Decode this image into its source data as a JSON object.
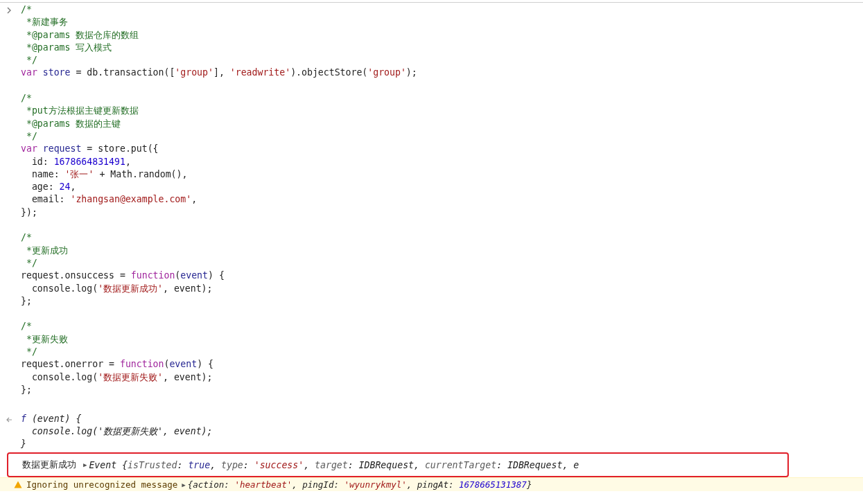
{
  "input": {
    "blocks": [
      [
        [
          {
            "text": "/*",
            "kind": "comment"
          }
        ],
        [
          {
            "text": " *新建事务",
            "kind": "comment"
          }
        ],
        [
          {
            "text": " *@params 数据仓库的数组",
            "kind": "comment"
          }
        ],
        [
          {
            "text": " *@params 写入模式",
            "kind": "comment"
          }
        ],
        [
          {
            "text": " */",
            "kind": "comment"
          }
        ],
        [
          {
            "text": "var",
            "kind": "kw"
          },
          {
            "text": "store",
            "kind": "ident"
          },
          {
            "text": "= db.transaction([",
            "kind": "plain"
          },
          {
            "text": "'group'",
            "kind": "str"
          },
          {
            "text": "],",
            "kind": "plain"
          },
          {
            "text": "'readwrite'",
            "kind": "str"
          },
          {
            "text": ").objectStore(",
            "kind": "plain"
          },
          {
            "text": "'group'",
            "kind": "str"
          },
          {
            "text": ");",
            "kind": "plain"
          }
        ]
      ],
      [
        [
          {
            "text": "/*",
            "kind": "comment"
          }
        ],
        [
          {
            "text": " *put方法根据主键更新数据",
            "kind": "comment"
          }
        ],
        [
          {
            "text": " *@params 数据的主键",
            "kind": "comment"
          }
        ],
        [
          {
            "text": " */",
            "kind": "comment"
          }
        ],
        [
          {
            "text": "var",
            "kind": "kw"
          },
          {
            "text": "request",
            "kind": "ident"
          },
          {
            "text": "= store.put({",
            "kind": "plain"
          }
        ],
        [
          {
            "text": "  id:",
            "kind": "plain"
          },
          {
            "text": "1678664831491",
            "kind": "num"
          },
          {
            "text": ",",
            "kind": "plain"
          }
        ],
        [
          {
            "text": "  name:",
            "kind": "plain"
          },
          {
            "text": "'张一'",
            "kind": "str"
          },
          {
            "text": "+ Math.random(),",
            "kind": "plain"
          }
        ],
        [
          {
            "text": "  age:",
            "kind": "plain"
          },
          {
            "text": "24",
            "kind": "num"
          },
          {
            "text": ",",
            "kind": "plain"
          }
        ],
        [
          {
            "text": "  email:",
            "kind": "plain"
          },
          {
            "text": "'zhangsan@example.com'",
            "kind": "str"
          },
          {
            "text": ",",
            "kind": "plain"
          }
        ],
        [
          {
            "text": "});",
            "kind": "plain"
          }
        ]
      ],
      [
        [
          {
            "text": "/*",
            "kind": "comment"
          }
        ],
        [
          {
            "text": " *更新成功",
            "kind": "comment"
          }
        ],
        [
          {
            "text": " */",
            "kind": "comment"
          }
        ],
        [
          {
            "text": "request.onsuccess =",
            "kind": "plain"
          },
          {
            "text": "function",
            "kind": "kw"
          },
          {
            "text": "(",
            "kind": "plain"
          },
          {
            "text": "event",
            "kind": "ident"
          },
          {
            "text": ") {",
            "kind": "plain"
          }
        ],
        [
          {
            "text": "  console.log(",
            "kind": "plain"
          },
          {
            "text": "'数据更新成功'",
            "kind": "str"
          },
          {
            "text": ", event);",
            "kind": "plain"
          }
        ],
        [
          {
            "text": "};",
            "kind": "plain"
          }
        ]
      ],
      [
        [
          {
            "text": "/*",
            "kind": "comment"
          }
        ],
        [
          {
            "text": " *更新失败",
            "kind": "comment"
          }
        ],
        [
          {
            "text": " */",
            "kind": "comment"
          }
        ],
        [
          {
            "text": "request.onerror =",
            "kind": "plain"
          },
          {
            "text": "function",
            "kind": "kw"
          },
          {
            "text": "(",
            "kind": "plain"
          },
          {
            "text": "event",
            "kind": "ident"
          },
          {
            "text": ") {",
            "kind": "plain"
          }
        ],
        [
          {
            "text": "  console.log(",
            "kind": "plain"
          },
          {
            "text": "'数据更新失败'",
            "kind": "str"
          },
          {
            "text": ", event);",
            "kind": "plain"
          }
        ],
        [
          {
            "text": "};",
            "kind": "plain"
          }
        ]
      ]
    ]
  },
  "result": {
    "lines": [
      [
        {
          "text": "f",
          "kind": "ident"
        },
        {
          "text": "(event) {",
          "kind": "plain"
        }
      ],
      [
        {
          "text": "  console.log('数据更新失败', event);",
          "kind": "plain"
        }
      ],
      [
        {
          "text": "}",
          "kind": "plain"
        }
      ]
    ]
  },
  "log": {
    "highlighted": true,
    "message": "数据更新成功",
    "arrow": "▶",
    "tokens": [
      {
        "text": "Event {",
        "kind": "plain"
      },
      {
        "text": "isTrusted",
        "kind": "key"
      },
      {
        "text": ":",
        "kind": "plain"
      },
      {
        "text": "true",
        "kind": "ident"
      },
      {
        "text": ",",
        "kind": "plain"
      },
      {
        "text": "type",
        "kind": "key"
      },
      {
        "text": ":",
        "kind": "plain"
      },
      {
        "text": "'success'",
        "kind": "str"
      },
      {
        "text": ",",
        "kind": "plain"
      },
      {
        "text": "target",
        "kind": "key"
      },
      {
        "text": ": IDBRequest,",
        "kind": "plain"
      },
      {
        "text": "currentTarget",
        "kind": "key"
      },
      {
        "text": ": IDBRequest, e",
        "kind": "plain"
      }
    ]
  },
  "warning": {
    "message": "Ignoring unrecognized message",
    "arrow": "▶",
    "tokens": [
      {
        "text": "{action:",
        "kind": "plain"
      },
      {
        "text": "'heartbeat'",
        "kind": "str"
      },
      {
        "text": ", pingId:",
        "kind": "plain"
      },
      {
        "text": "'wyunrykmyl'",
        "kind": "str"
      },
      {
        "text": ", pingAt:",
        "kind": "plain"
      },
      {
        "text": "1678665131387",
        "kind": "num"
      },
      {
        "text": "}",
        "kind": "plain"
      }
    ]
  }
}
